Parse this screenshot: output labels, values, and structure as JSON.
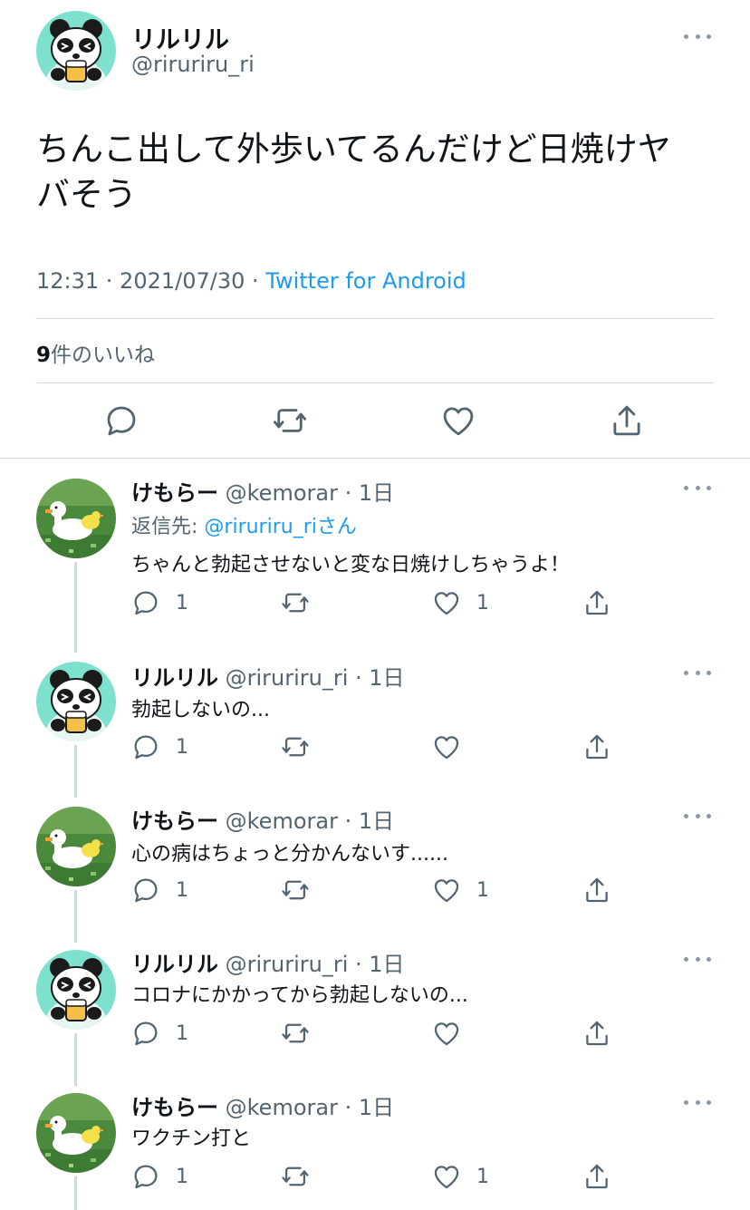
{
  "main": {
    "name": "リルリル",
    "handle": "@riruriru_ri",
    "text_line1": "ちんこ出して外歩いてるんだけど日焼けヤ",
    "text_line2": "バそう",
    "time": "12:31 · 2021/07/30 · ",
    "source": "Twitter for Android",
    "likes_count": "9",
    "likes_label": "件のいいね"
  },
  "replies": [
    {
      "name": "けもらー",
      "meta": " @kemorar · 1日",
      "replying_label": "返信先: ",
      "replying_handle": "@riruriru_riさん",
      "text": "ちゃんと勃起させないと変な日焼けしちゃうよ！",
      "reply_count": "1",
      "like_count": "1"
    },
    {
      "name": "リルリル",
      "meta": " @riruriru_ri · 1日",
      "text": "勃起しないの...",
      "reply_count": "1",
      "like_count": ""
    },
    {
      "name": "けもらー",
      "meta": " @kemorar · 1日",
      "text": "心の病はちょっと分かんないす......",
      "reply_count": "1",
      "like_count": "1"
    },
    {
      "name": "リルリル",
      "meta": " @riruriru_ri · 1日",
      "text": "コロナにかかってから勃起しないの...",
      "reply_count": "1",
      "like_count": ""
    },
    {
      "name": "けもらー",
      "meta": " @kemorar · 1日",
      "text": "ワクチン打と",
      "reply_count": "1",
      "like_count": "1"
    }
  ],
  "icons": {
    "reply": "speech-bubble-icon",
    "retweet": "retweet-icon",
    "like": "heart-icon",
    "share": "share-icon",
    "more": "more-icon"
  },
  "colors": {
    "accent": "#1d9bf0",
    "secondary_text": "#536471",
    "divider": "#cfd9de"
  }
}
